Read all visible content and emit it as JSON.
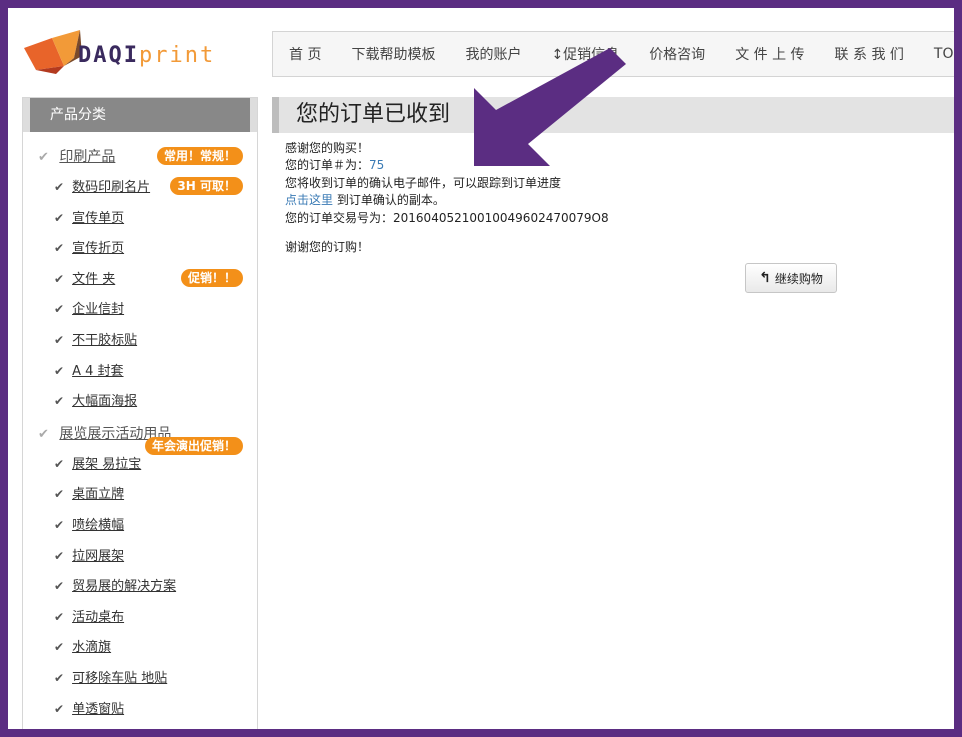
{
  "logo": {
    "daqi": "DAQI",
    "print": "print"
  },
  "nav": [
    {
      "label": "首 页"
    },
    {
      "label": "下载帮助模板"
    },
    {
      "label": "我的账户"
    },
    {
      "label": "↕促销信息"
    },
    {
      "label": "价格咨询"
    },
    {
      "label": "文 件 上 传"
    },
    {
      "label": "联 系 我 们"
    },
    {
      "label": "TO"
    }
  ],
  "sidebar": {
    "title": "产品分类",
    "cat1": {
      "label": "印刷产品",
      "badge": "常用！常规！"
    },
    "cat1_items": [
      {
        "label": "数码印刷名片",
        "badge": "3H 可取！"
      },
      {
        "label": "宣传单页",
        "badge": ""
      },
      {
        "label": "宣传折页",
        "badge": ""
      },
      {
        "label": "文件 夹",
        "badge": "促销！！"
      },
      {
        "label": "企业信封",
        "badge": ""
      },
      {
        "label": "不干胶标贴",
        "badge": ""
      },
      {
        "label": "A 4 封套",
        "badge": ""
      },
      {
        "label": "大幅面海报",
        "badge": ""
      }
    ],
    "cat2": {
      "label": "展览展示活动用品"
    },
    "cat2_items": [
      {
        "label": "展架 易拉宝",
        "badge": "年会演出促销！"
      },
      {
        "label": "桌面立牌",
        "badge": ""
      },
      {
        "label": "喷绘横幅",
        "badge": ""
      },
      {
        "label": "拉网展架",
        "badge": ""
      },
      {
        "label": "贸易展的解决方案",
        "badge": ""
      },
      {
        "label": "活动桌布",
        "badge": ""
      },
      {
        "label": "水滴旗",
        "badge": ""
      },
      {
        "label": "可移除车贴 地贴",
        "badge": ""
      },
      {
        "label": "单透窗贴",
        "badge": ""
      }
    ]
  },
  "main": {
    "title": "您的订单已收到",
    "thanks": "感谢您的购买！",
    "order_label": "您的订单＃为：",
    "order_number": "75",
    "email_note": "您将收到订单的确认电子邮件，可以跟踪到订单进度",
    "click_link": "点击这里",
    "click_rest": " 到订单确认的副本。",
    "txn_label": "您的订单交易号为：",
    "txn_number": "20160405210010049602470079O8",
    "thanks2": "谢谢您的订购！",
    "continue_button": "继续购物"
  },
  "colors": {
    "border": "#5b2d82",
    "badge": "#f39019",
    "link": "#3b7bb5",
    "arrow": "#5b2d82"
  }
}
